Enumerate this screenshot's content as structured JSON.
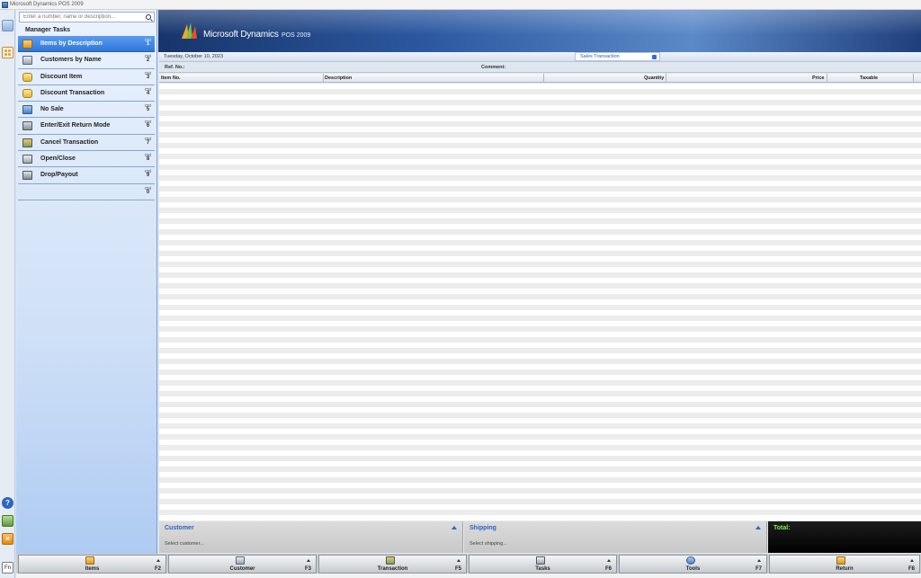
{
  "window": {
    "title": "Microsoft Dynamics POS 2009"
  },
  "search": {
    "placeholder": "Enter a number, name or description..."
  },
  "manager_tasks": {
    "header": "Manager Tasks",
    "items": [
      {
        "label": "Items by Description",
        "key_mod": "Ctrl",
        "key_num": "1",
        "icon": "box-icon",
        "selected": true
      },
      {
        "label": "Customers by Name",
        "key_mod": "Ctrl",
        "key_num": "2",
        "icon": "customers-icon"
      },
      {
        "label": "Discount Item",
        "key_mod": "Ctrl",
        "key_num": "3",
        "icon": "discount-item-icon"
      },
      {
        "label": "Discount Transaction",
        "key_mod": "Ctrl",
        "key_num": "4",
        "icon": "discount-transaction-icon"
      },
      {
        "label": "No Sale",
        "key_mod": "Ctrl",
        "key_num": "5",
        "icon": "no-sale-icon"
      },
      {
        "label": "Enter/Exit Return Mode",
        "key_mod": "Ctrl",
        "key_num": "6",
        "icon": "return-mode-icon"
      },
      {
        "label": "Cancel Transaction",
        "key_mod": "Ctrl",
        "key_num": "7",
        "icon": "cancel-transaction-icon"
      },
      {
        "label": "Open/Close",
        "key_mod": "Ctrl",
        "key_num": "8",
        "icon": "open-close-icon"
      },
      {
        "label": "Drop/Payout",
        "key_mod": "Ctrl",
        "key_num": "9",
        "icon": "drop-payout-icon"
      },
      {
        "label": "",
        "key_mod": "Ctrl",
        "key_num": "0",
        "icon": ""
      }
    ]
  },
  "banner": {
    "brand": "Microsoft Dynamics",
    "product": "POS 2009"
  },
  "transaction": {
    "date": "Tuesday, October 10, 2023",
    "type": "Sales Transaction",
    "ref_label": "Ref. No.:",
    "comment_label": "Comment:"
  },
  "grid": {
    "columns": [
      "Item No.",
      "Description",
      "Quantity",
      "Price",
      "Taxable"
    ]
  },
  "panels": {
    "customer": {
      "title": "Customer",
      "sub": "Select customer..."
    },
    "shipping": {
      "title": "Shipping",
      "sub": "Select shipping..."
    },
    "total": {
      "title": "Total:"
    }
  },
  "function_keys": [
    {
      "label": "Items",
      "key": "F2",
      "icon": "items-icon"
    },
    {
      "label": "Customer",
      "key": "F3",
      "icon": "customer-icon"
    },
    {
      "label": "Transaction",
      "key": "F5",
      "icon": "transaction-icon"
    },
    {
      "label": "Tasks",
      "key": "F6",
      "icon": "tasks-icon"
    },
    {
      "label": "Tools",
      "key": "F7",
      "icon": "tools-icon"
    },
    {
      "label": "Return",
      "key": "F8",
      "icon": "return-icon"
    }
  ],
  "rail": {
    "help_glyph": "?",
    "exit_glyph": "×",
    "kb_glyph": "Fn"
  },
  "colors": {
    "accent": "#2f77dc",
    "total_text": "#7cf046",
    "banner": "#2c58a0"
  }
}
